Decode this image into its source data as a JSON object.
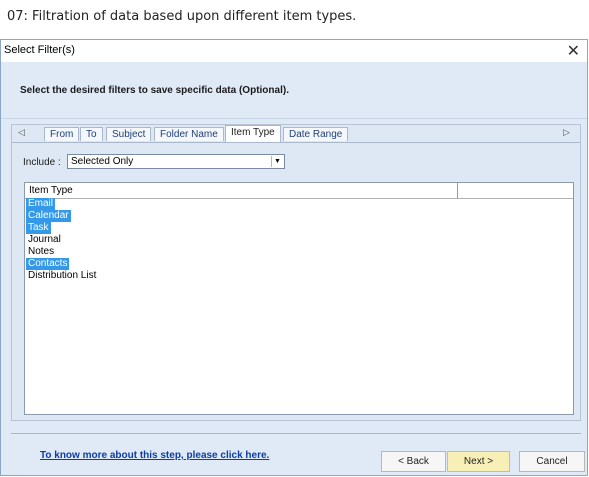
{
  "caption": "07: Filtration of data based upon different item types.",
  "window": {
    "title": "Select Filter(s)",
    "close_glyph": "✕"
  },
  "header": {
    "instruction": "Select the desired filters to save specific data (Optional)."
  },
  "tabs": {
    "left_arrow": "◁",
    "right_arrow": "▷",
    "items": [
      {
        "label": "From",
        "active": false
      },
      {
        "label": "To",
        "active": false
      },
      {
        "label": "Subject",
        "active": false
      },
      {
        "label": "Folder Name",
        "active": false
      },
      {
        "label": "Item Type",
        "active": true
      },
      {
        "label": "Date Range",
        "active": false
      }
    ]
  },
  "include": {
    "label": "Include :",
    "selected_value": "Selected Only",
    "dropdown_glyph": "▼"
  },
  "list": {
    "column_header": "Item Type",
    "rows": [
      {
        "label": "Email",
        "selected": true
      },
      {
        "label": "Calendar",
        "selected": true
      },
      {
        "label": "Task",
        "selected": true
      },
      {
        "label": "Journal",
        "selected": false
      },
      {
        "label": "Notes",
        "selected": false
      },
      {
        "label": "Contacts",
        "selected": true
      },
      {
        "label": "Distribution List",
        "selected": false
      }
    ]
  },
  "footer": {
    "help_link": "To know more about this step, please click here.",
    "back_label": "< Back",
    "next_label": "Next >",
    "cancel_label": "Cancel"
  },
  "colors": {
    "selection": "#3399e8",
    "dialog_bg": "#dfeaf6",
    "link": "#0b3ca8",
    "next_button": "#f7efb6"
  }
}
